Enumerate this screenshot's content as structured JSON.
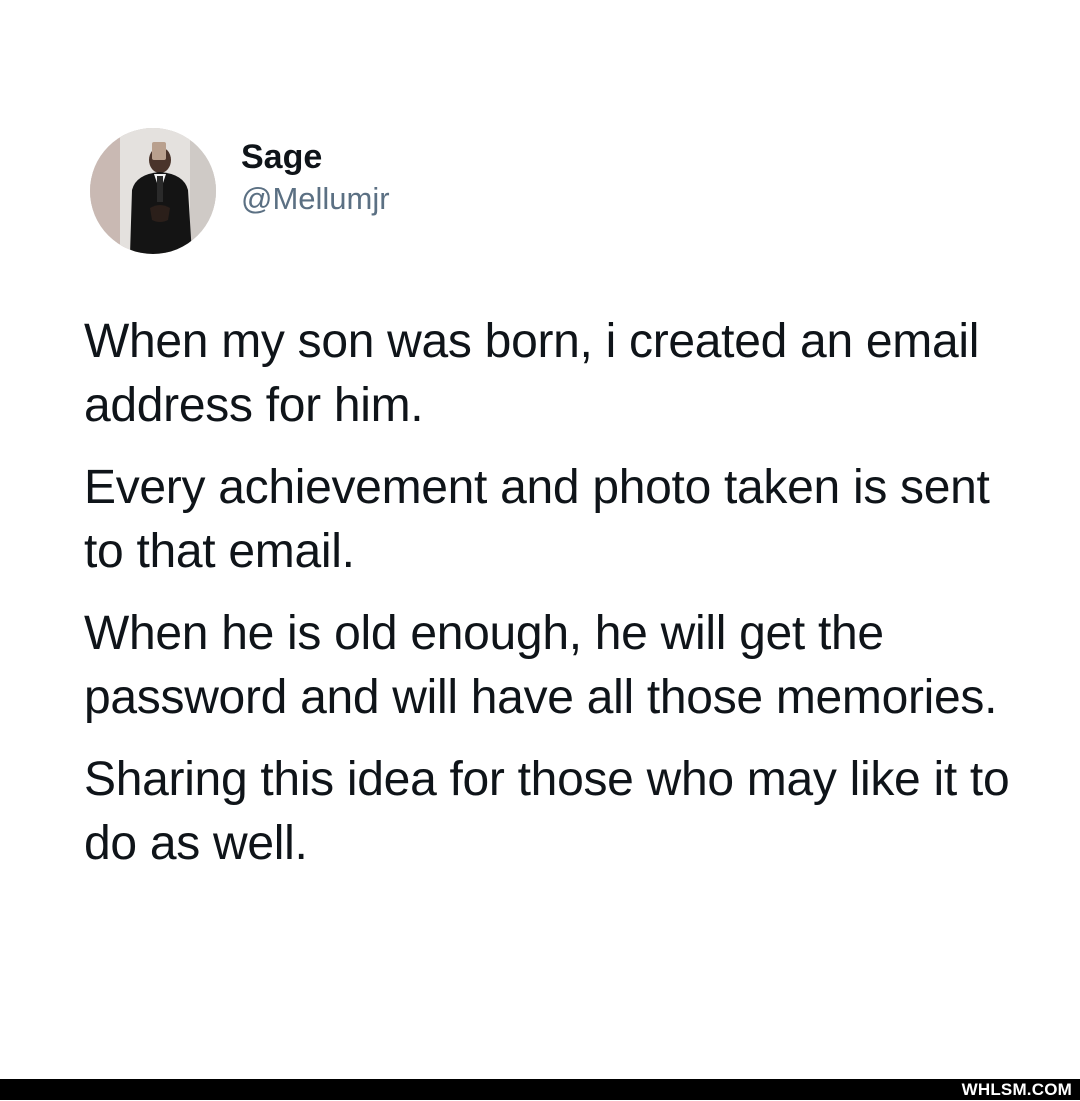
{
  "tweet": {
    "author": {
      "display_name": "Sage",
      "handle": "@Mellumjr"
    },
    "paragraphs": [
      "When my son was born, i created an email address for him.",
      "Every achievement and photo taken is sent to that email.",
      "When he is old enough, he will get the password and will have all those memories.",
      "Sharing this idea for those who may like it to do as well."
    ]
  },
  "footer": {
    "watermark": "WHLSM.COM"
  },
  "colors": {
    "text": "#0f1419",
    "handle": "#5b7083",
    "background": "#ffffff",
    "footer_bar": "#000000"
  }
}
